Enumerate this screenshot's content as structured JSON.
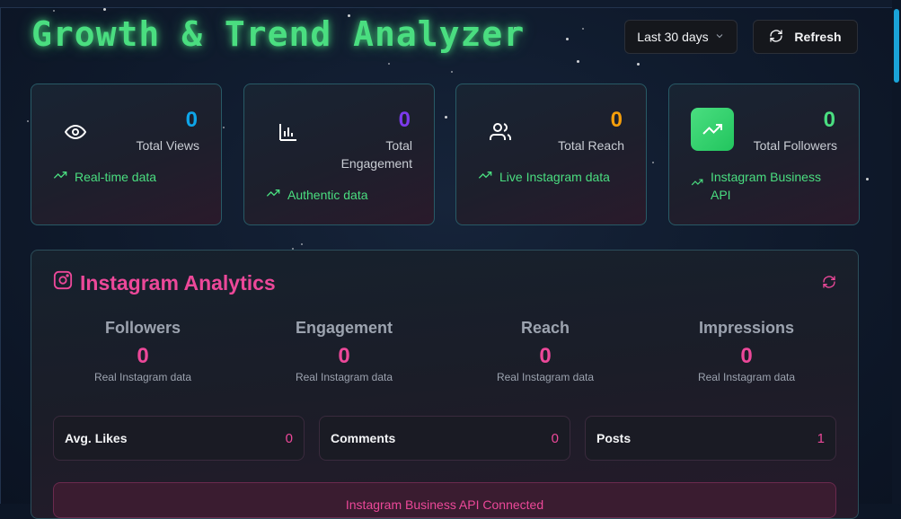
{
  "header": {
    "title": "Growth & Trend Analyzer",
    "date_range": "Last 30 days",
    "refresh_label": "Refresh"
  },
  "stats": [
    {
      "value": "0",
      "label": "Total Views",
      "foot": "Real-time data",
      "icon": "eye-icon",
      "color": "#0ea5e9"
    },
    {
      "value": "0",
      "label": "Total Engagement",
      "foot": "Authentic data",
      "icon": "bar-chart-icon",
      "color": "#7c3aed"
    },
    {
      "value": "0",
      "label": "Total Reach",
      "foot": "Live Instagram data",
      "icon": "users-icon",
      "color": "#f59e0b"
    },
    {
      "value": "0",
      "label": "Total Followers",
      "foot": "Instagram Business API",
      "icon": "trending-up-icon",
      "color": "#4ade80"
    }
  ],
  "analytics": {
    "title": "Instagram Analytics",
    "metrics": [
      {
        "label": "Followers",
        "value": "0",
        "sub": "Real Instagram data"
      },
      {
        "label": "Engagement",
        "value": "0",
        "sub": "Real Instagram data"
      },
      {
        "label": "Reach",
        "value": "0",
        "sub": "Real Instagram data"
      },
      {
        "label": "Impressions",
        "value": "0",
        "sub": "Real Instagram data"
      }
    ],
    "details": [
      {
        "label": "Avg. Likes",
        "value": "0"
      },
      {
        "label": "Comments",
        "value": "0"
      },
      {
        "label": "Posts",
        "value": "1"
      }
    ],
    "status_banner": "Instagram Business API Connected"
  },
  "colors": {
    "accent_green": "#4ade80",
    "accent_pink": "#ec4899",
    "background": "#0f1a2c"
  }
}
